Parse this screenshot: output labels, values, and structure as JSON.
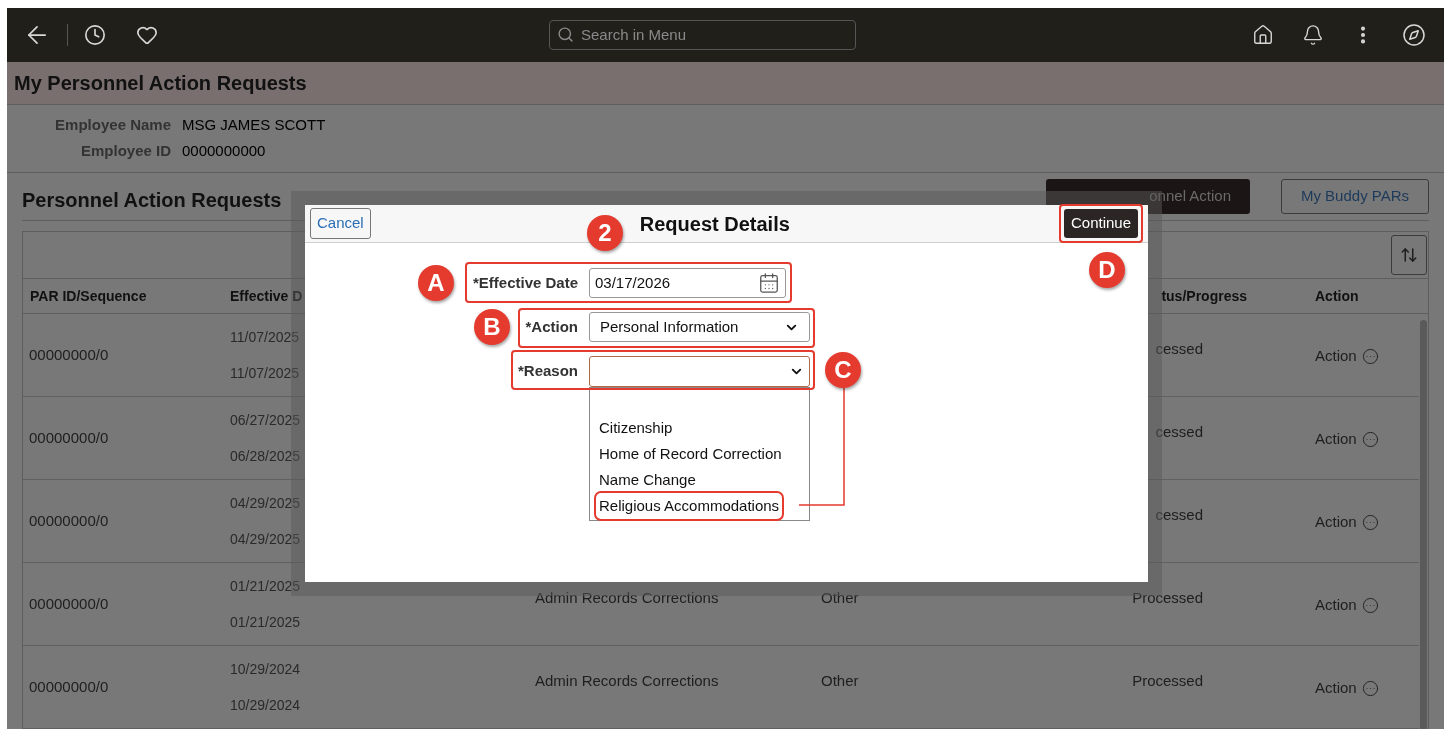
{
  "nav": {
    "search_placeholder": "Search in Menu"
  },
  "page_title": "My Personnel Action Requests",
  "employee": [
    {
      "label": "Employee Name",
      "value": "MSG JAMES SCOTT"
    },
    {
      "label": "Employee ID",
      "value": "0000000000"
    }
  ],
  "section": {
    "title": "Personnel Action Requests",
    "buttons": [
      {
        "label": "onnel Action",
        "kind": "primary"
      },
      {
        "label": "My Buddy PARs",
        "kind": "secondary"
      }
    ]
  },
  "table": {
    "columns": [
      "PAR ID/Sequence",
      "Effective D",
      "tus/Progress",
      "Action"
    ],
    "rows": [
      {
        "par_id": "00000000/0",
        "dates": [
          "11/07/2025",
          "11/07/2025"
        ],
        "status": "cessed",
        "action": "Action"
      },
      {
        "par_id": "00000000/0",
        "dates": [
          "06/27/2025",
          "06/28/2025"
        ],
        "status": "cessed",
        "action": "Action"
      },
      {
        "par_id": "00000000/0",
        "dates": [
          "04/29/2025",
          "04/29/2025"
        ],
        "status": "cessed",
        "action": "Action"
      },
      {
        "par_id": "00000000/0",
        "dates": [
          "01/21/2025",
          "01/21/2025"
        ],
        "column_4": "Admin Records Corrections",
        "column_5": "Other",
        "status": "Processed",
        "action": "Action"
      },
      {
        "par_id": "00000000/0",
        "dates": [
          "10/29/2024",
          "10/29/2024"
        ],
        "column_4": "Admin Records Corrections",
        "column_5": "Other",
        "status": "Processed",
        "action": "Action"
      }
    ]
  },
  "modal": {
    "title": "Request Details",
    "cancel": "Cancel",
    "continue": {
      "label": "Continue",
      "annotated": true
    },
    "effective_date": {
      "label": "*Effective Date",
      "value": "03/17/2026"
    },
    "action": {
      "label": "*Action",
      "value": "Personal Information"
    },
    "reason": {
      "label": "*Reason",
      "expanded": true,
      "options": [
        {
          "label": "Citizenship",
          "annotated": false
        },
        {
          "label": "Home of Record Correction",
          "annotated": false
        },
        {
          "label": "Name Change",
          "annotated": false
        },
        {
          "label": "Religious Accommodations",
          "annotated": true
        }
      ]
    }
  },
  "callouts": [
    {
      "label": "2"
    },
    {
      "label": "A"
    },
    {
      "label": "B"
    },
    {
      "label": "C"
    },
    {
      "label": "D"
    }
  ]
}
